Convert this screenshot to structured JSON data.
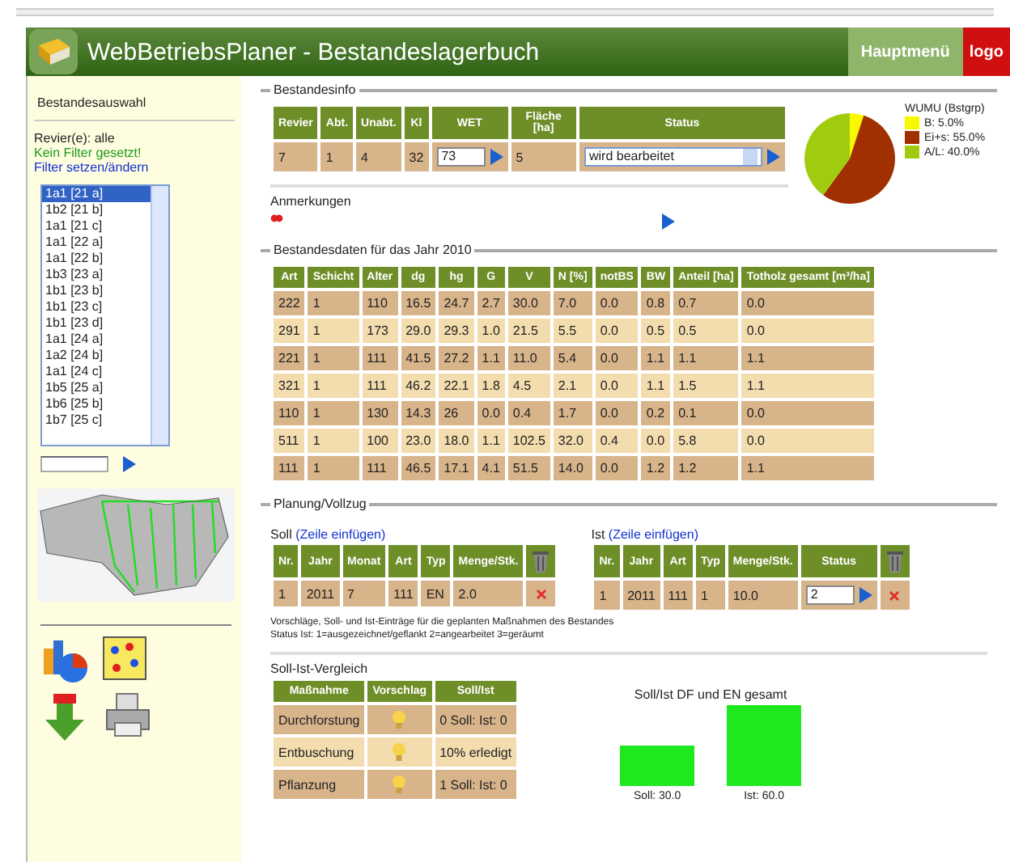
{
  "header": {
    "title": "WebBetriebsPlaner - Bestandeslagerbuch",
    "nav": [
      {
        "label": "Hauptmenü",
        "kind": "menu"
      },
      {
        "label": "logo",
        "kind": "logout"
      }
    ]
  },
  "sidebar": {
    "title": "Bestandesauswahl",
    "revier": "Revier(e): alle",
    "filter_status": "Kein Filter gesetzt!",
    "filter_link": "Filter setzen/ändern",
    "stands": [
      {
        "label": "1a1 [21 a]",
        "selected": true
      },
      {
        "label": "1b2 [21 b]",
        "selected": false
      },
      {
        "label": "1a1 [21 c]",
        "selected": false
      },
      {
        "label": "1a1 [22 a]",
        "selected": false
      },
      {
        "label": "1a1 [22 b]",
        "selected": false
      },
      {
        "label": "1b3 [23 a]",
        "selected": false
      },
      {
        "label": "1b1 [23 b]",
        "selected": false
      },
      {
        "label": "1b1 [23 c]",
        "selected": false
      },
      {
        "label": "1b1 [23 d]",
        "selected": false
      },
      {
        "label": "1a1 [24 a]",
        "selected": false
      },
      {
        "label": "1a2 [24 b]",
        "selected": false
      },
      {
        "label": "1a1 [24 c]",
        "selected": false
      },
      {
        "label": "1b5 [25 a]",
        "selected": false
      },
      {
        "label": "1b6 [25 b]",
        "selected": false
      },
      {
        "label": "1b7 [25 c]",
        "selected": false
      }
    ]
  },
  "stand_info": {
    "legend": "Bestandesinfo",
    "columns": [
      "Revier",
      "Abt.",
      "Unabt.",
      "Kl",
      "WET",
      "Fläche [ha]",
      "Status"
    ],
    "cells": [
      {
        "kind": "text",
        "value": "7"
      },
      {
        "kind": "text",
        "value": "1"
      },
      {
        "kind": "text",
        "value": "4"
      },
      {
        "kind": "text",
        "value": "32"
      },
      {
        "kind": "input",
        "value": "73"
      },
      {
        "kind": "text",
        "value": "5"
      },
      {
        "kind": "select",
        "value": "wird bearbeitet"
      }
    ],
    "remarks_label": "Anmerkungen",
    "chart_data": {
      "type": "pie",
      "title": "WUMU (Bstgrp)",
      "categories": [
        "B: 5.0%",
        "Ei+s: 55.0%",
        "A/L: 40.0%"
      ],
      "values": [
        5,
        55,
        40
      ],
      "legend": "right"
    }
  },
  "stand_data": {
    "legend": "Bestandesdaten für das Jahr 2010",
    "columns": [
      "Art",
      "Schicht",
      "Alter",
      "dg",
      "hg",
      "G",
      "V",
      "N [%]",
      "notBS",
      "BW",
      "Anteil [ha]",
      "Totholz gesamt [m³/ha]"
    ],
    "rows": [
      [
        "222",
        "1",
        "110",
        "16.5",
        "24.7",
        "2.7",
        "30.0",
        "7.0",
        "0.0",
        "0.8",
        "0.7",
        "0.0"
      ],
      [
        "291",
        "1",
        "173",
        "29.0",
        "29.3",
        "1.0",
        "21.5",
        "5.5",
        "0.0",
        "0.5",
        "0.5",
        "0.0"
      ],
      [
        "221",
        "1",
        "111",
        "41.5",
        "27.2",
        "1.1",
        "11.0",
        "5.4",
        "0.0",
        "1.1",
        "1.1",
        "1.1"
      ],
      [
        "321",
        "1",
        "111",
        "46.2",
        "22.1",
        "1.8",
        "4.5",
        "2.1",
        "0.0",
        "1.1",
        "1.5",
        "1.1"
      ],
      [
        "110",
        "1",
        "130",
        "14.3",
        "26",
        "0.0",
        "0.4",
        "1.7",
        "0.0",
        "0.2",
        "0.1",
        "0.0"
      ],
      [
        "511",
        "1",
        "100",
        "23.0",
        "18.0",
        "1.1",
        "102.5",
        "32.0",
        "0.4",
        "0.0",
        "5.8",
        "0.0"
      ],
      [
        "111",
        "1",
        "111",
        "46.5",
        "17.1",
        "4.1",
        "51.5",
        "14.0",
        "0.0",
        "1.2",
        "1.2",
        "1.1"
      ]
    ]
  },
  "planning": {
    "legend": "Planung/Vollzug",
    "plan": {
      "label": "Soll",
      "link": "(Zeile einfügen)",
      "columns": [
        "Nr.",
        "Jahr",
        "Monat",
        "Art",
        "Typ",
        "Menge/Stk."
      ],
      "rows": [
        [
          "1",
          "2011",
          "7",
          "111",
          "EN",
          "2.0"
        ]
      ]
    },
    "done": {
      "label": "Ist",
      "link": "(Zeile einfügen)",
      "columns": [
        "Nr.",
        "Jahr",
        "Art",
        "Typ",
        "Menge/Stk.",
        "Status"
      ],
      "rows": [
        {
          "cells": [
            "1",
            "2011",
            "111",
            "1",
            "10.0"
          ],
          "status": "2"
        }
      ]
    },
    "notes": [
      "Vorschläge, Soll- und Ist-Einträge für die geplanten Maßnahmen des Bestandes",
      "Status Ist:  1=ausgezeichnet/geflankt  2=angearbeitet  3=geräumt"
    ]
  },
  "comparison": {
    "title": "Soll-Ist-Vergleich",
    "columns": [
      "Maßnahme",
      "Vorschlag",
      "Soll/Ist"
    ],
    "rows": [
      [
        "Durchforstung",
        "0 Soll: Ist: 0"
      ],
      [
        "Entbuschung",
        "10% erledigt"
      ],
      [
        "Pflanzung",
        "1 Soll: Ist: 0"
      ]
    ],
    "bar_title": "Soll/Ist DF und EN gesamt",
    "bars": [
      {
        "label": "Soll: 30.0"
      },
      {
        "label": "Ist: 60.0"
      }
    ]
  }
}
